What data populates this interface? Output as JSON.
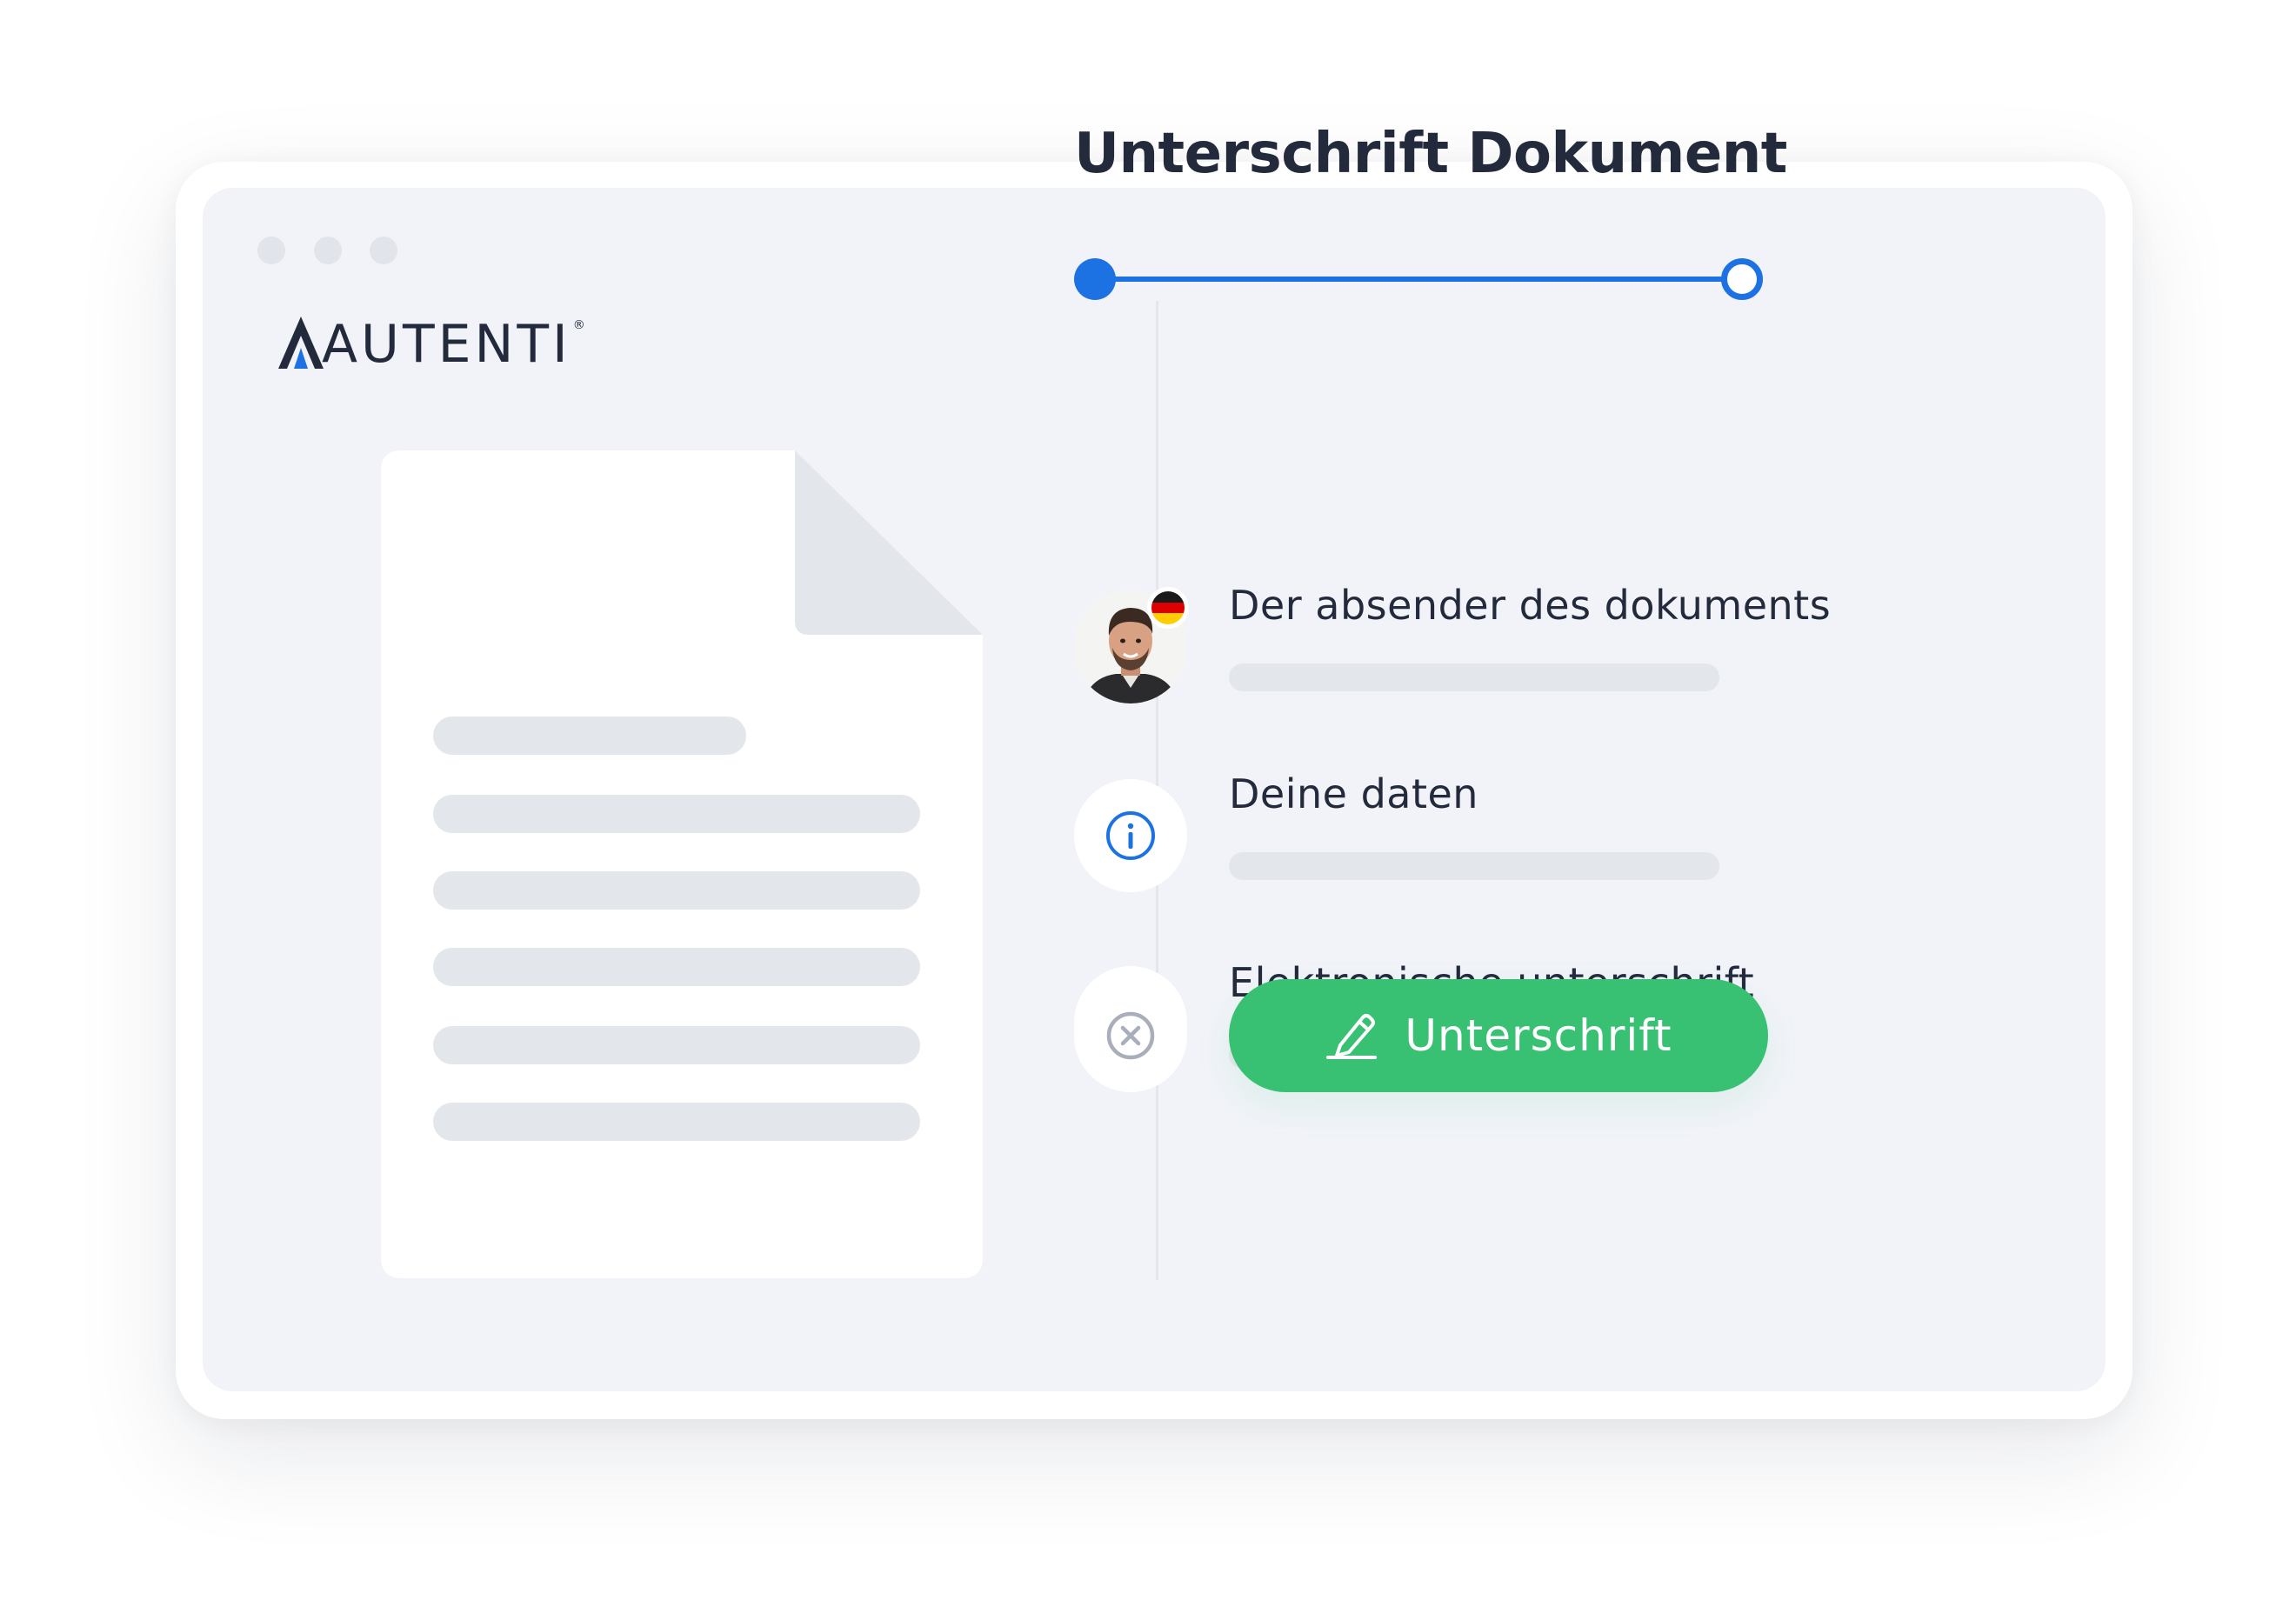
{
  "brand": {
    "name": "AUTENTI",
    "accent_color": "#1d72e3"
  },
  "panel": {
    "title": "Unterschrift Dokument",
    "progress_value": 1.0
  },
  "steps": [
    {
      "label": "Der absender des dokuments",
      "icon": "sender-avatar",
      "badge": "german-flag-icon"
    },
    {
      "label": "Deine daten",
      "icon": "info-icon"
    },
    {
      "label": "Elektronische unterschrift",
      "icon": "verified-badge-icon"
    }
  ],
  "actions": {
    "cancel_icon": "close-circle-icon",
    "sign_label": "Unterschrift",
    "sign_icon": "pen-icon",
    "sign_color": "#38c172"
  }
}
